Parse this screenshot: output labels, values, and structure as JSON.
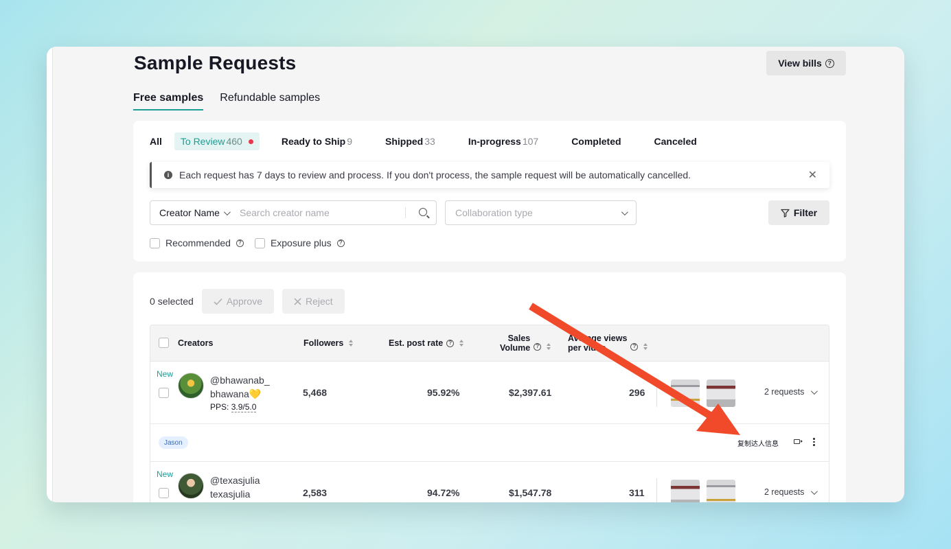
{
  "page": {
    "title": "Sample Requests",
    "view_bills_label": "View bills"
  },
  "main_tabs": [
    {
      "label": "Free samples",
      "active": true
    },
    {
      "label": "Refundable samples",
      "active": false
    }
  ],
  "status_tabs": [
    {
      "label": "All",
      "count": ""
    },
    {
      "label": "To Review",
      "count": "460",
      "active": true
    },
    {
      "label": "Ready to Ship",
      "count": "9"
    },
    {
      "label": "Shipped",
      "count": "33"
    },
    {
      "label": "In-progress",
      "count": "107"
    },
    {
      "label": "Completed",
      "count": ""
    },
    {
      "label": "Canceled",
      "count": ""
    }
  ],
  "notice": {
    "text": "Each request has 7 days to review and process. If you don't process, the sample request will be automatically cancelled."
  },
  "search": {
    "field_select": "Creator Name",
    "placeholder": "Search creator name",
    "collab_placeholder": "Collaboration type",
    "filter_label": "Filter"
  },
  "checkboxes": {
    "recommended": "Recommended",
    "exposure_plus": "Exposure plus"
  },
  "toolbar": {
    "selected_count": "0",
    "selected_label": "selected",
    "approve_label": "Approve",
    "reject_label": "Reject"
  },
  "table": {
    "headers": {
      "creators": "Creators",
      "followers": "Followers",
      "post_rate": "Est. post rate",
      "sales_line1": "Sales",
      "sales_line2": "Volume",
      "views_line1": "Average views",
      "views_line2": "per video"
    },
    "rows": [
      {
        "badge": "New",
        "handle": "@bhawanab_",
        "name": "bhawana💛",
        "pps_label": "PPS:",
        "pps_value": "3.9/5.0",
        "followers": "5,468",
        "post_rate": "95.92%",
        "sales": "$2,397.61",
        "avg_views": "296",
        "requests": "2 requests"
      },
      {
        "badge": "New",
        "handle": "@texasjulia",
        "name": "texasjulia",
        "followers": "2,583",
        "post_rate": "94.72%",
        "sales": "$1,547.78",
        "avg_views": "311",
        "requests": "2 requests"
      }
    ],
    "sub_row": {
      "tag": "Jason",
      "copy_info": "复制达人信息"
    }
  },
  "colors": {
    "accent": "#1a9e96",
    "arrow": "#f04a2a",
    "alert_dot": "#e8364b"
  },
  "icons": [
    "question-icon",
    "info-icon",
    "close-icon",
    "search-icon",
    "chevron-down-icon",
    "filter-icon",
    "check-icon",
    "x-icon",
    "sort-icon",
    "video-icon",
    "more-icon",
    "arrow-annotation"
  ]
}
